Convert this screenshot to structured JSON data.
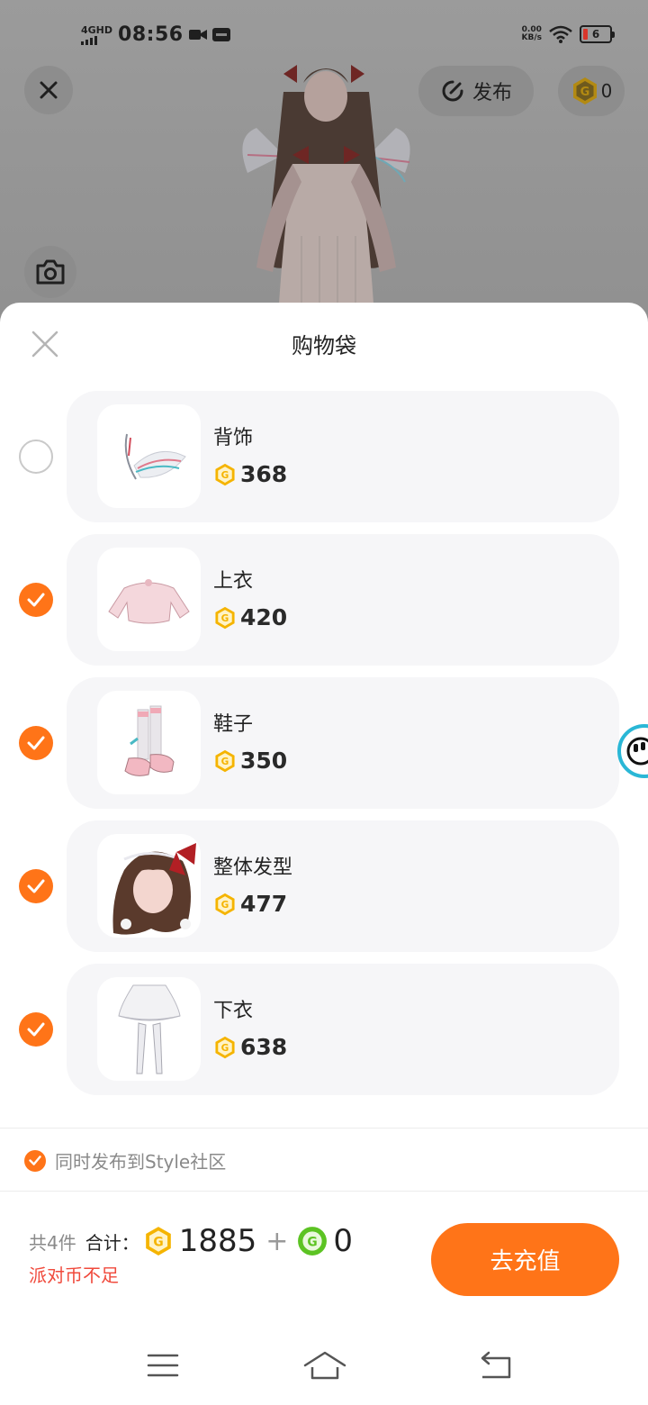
{
  "status_bar": {
    "network": "4GHD",
    "time": "08:56",
    "net_speed_value": "0.00",
    "net_speed_unit": "KB/s",
    "battery_level": "6"
  },
  "top_bar": {
    "close_icon": "close-icon",
    "publish_label": "发布",
    "coin_balance": "0"
  },
  "sheet": {
    "title": "购物袋",
    "items": [
      {
        "name": "背饰",
        "price": "368",
        "selected": false,
        "thumb": "back-accessory"
      },
      {
        "name": "上衣",
        "price": "420",
        "selected": true,
        "thumb": "top"
      },
      {
        "name": "鞋子",
        "price": "350",
        "selected": true,
        "thumb": "shoes"
      },
      {
        "name": "整体发型",
        "price": "477",
        "selected": true,
        "thumb": "hairstyle"
      },
      {
        "name": "下衣",
        "price": "638",
        "selected": true,
        "thumb": "bottom"
      }
    ],
    "sync_label": "同时发布到Style社区",
    "summary": {
      "count": "共4件",
      "total_label": "合计：",
      "gold_total": "1885",
      "plus": "+",
      "green_total": "0",
      "warning": "派对币不足"
    },
    "recharge_label": "去充值"
  },
  "colors": {
    "accent": "#ff7418",
    "warning": "#f04a3c",
    "coin_gold": "#f5b400",
    "coin_green": "#5cc323"
  },
  "nav": {
    "menu_icon": "menu-icon",
    "home_icon": "home-icon",
    "back_icon": "back-icon"
  }
}
